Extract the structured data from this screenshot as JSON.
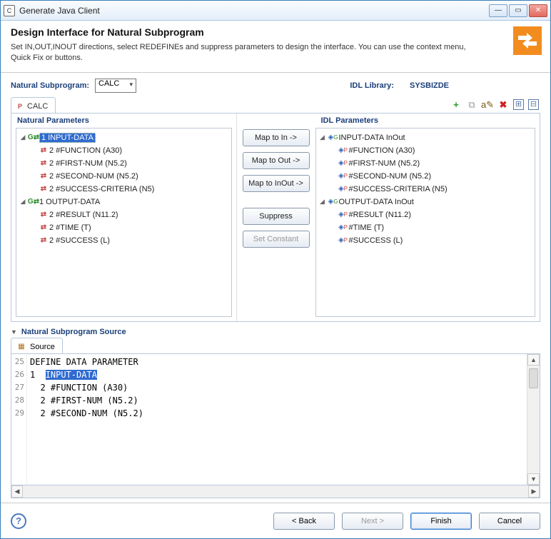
{
  "window": {
    "title": "Generate Java Client"
  },
  "header": {
    "title": "Design Interface for Natural Subprogram",
    "desc": "Set IN,OUT,INOUT directions, select REDEFINEs and suppress parameters to design the interface. You can use the context menu, Quick Fix or buttons."
  },
  "subprogram": {
    "label": "Natural Subprogram:",
    "value": "CALC",
    "idl_label": "IDL Library:",
    "idl_value": "SYSBIZDE"
  },
  "tab": {
    "label": "CALC"
  },
  "toolbar": {
    "add": "+",
    "copy": "⧉",
    "rename": "a✎",
    "delete": "✖",
    "expand": "⊞",
    "collapse": "⊟"
  },
  "panes": {
    "left_title": "Natural Parameters",
    "right_title": "IDL Parameters"
  },
  "natural_tree": {
    "n0": "1 INPUT-DATA",
    "n0c": [
      "2 #FUNCTION (A30)",
      "2 #FIRST-NUM (N5.2)",
      "2 #SECOND-NUM (N5.2)",
      "2 #SUCCESS-CRITERIA (N5)"
    ],
    "n1": "1 OUTPUT-DATA",
    "n1c": [
      "2 #RESULT (N11.2)",
      "2 #TIME (T)",
      "2 #SUCCESS (L)"
    ]
  },
  "idl_tree": {
    "n0": "INPUT-DATA  InOut",
    "n0c": [
      "#FUNCTION  (A30)",
      "#FIRST-NUM  (N5.2)",
      "#SECOND-NUM  (N5.2)",
      "#SUCCESS-CRITERIA  (N5)"
    ],
    "n1": "OUTPUT-DATA  InOut",
    "n1c": [
      "#RESULT  (N11.2)",
      "#TIME  (T)",
      "#SUCCESS  (L)"
    ]
  },
  "buttons": {
    "map_in": "Map to In ->",
    "map_out": "Map to Out ->",
    "map_inout": "Map to InOut ->",
    "suppress": "Suppress",
    "set_constant": "Set Constant"
  },
  "source": {
    "section_title": "Natural Subprogram Source",
    "tab_label": "Source",
    "lines": {
      "25": "DEFINE DATA PARAMETER",
      "26a": "1  ",
      "26b": "INPUT-DATA",
      "27": "  2 #FUNCTION (A30)",
      "28": "  2 #FIRST-NUM (N5.2)",
      "29": "  2 #SECOND-NUM (N5.2)"
    },
    "line_nums": [
      "25",
      "26",
      "27",
      "28",
      "29"
    ]
  },
  "footer": {
    "back": "< Back",
    "next": "Next >",
    "finish": "Finish",
    "cancel": "Cancel"
  }
}
